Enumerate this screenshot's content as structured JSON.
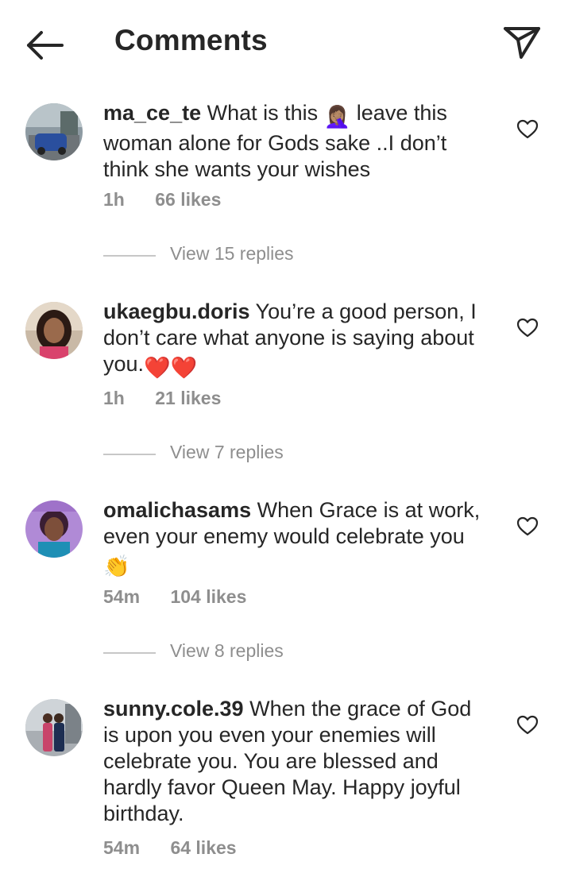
{
  "header": {
    "title": "Comments",
    "back_icon": "arrow-left-icon",
    "send_icon": "paper-plane-icon"
  },
  "colors": {
    "text": "#262626",
    "secondary": "#8e8e8e",
    "divider": "#c7c7c7",
    "heart_emoji": "#e0245e",
    "clap_emoji": "#f7c238"
  },
  "comments": [
    {
      "username": "ma_ce_te",
      "text_part1": " What is this ",
      "emoji": "🤦🏽‍♀️",
      "text_part2": " leave this woman alone for Gods sake ..I don’t think she wants your wishes",
      "time": "1h",
      "likes": "66 likes",
      "replies": "View 15 replies"
    },
    {
      "username": "ukaegbu.doris",
      "text_part1": " You’re a good person, I don’t care what anyone is saying about you.",
      "emoji": "❤️❤️",
      "time": "1h",
      "likes": "21 likes",
      "replies": "View 7 replies"
    },
    {
      "username": "omalichasams",
      "text_part1": " When Grace is at work, even your enemy would celebrate you ",
      "emoji": "👏",
      "time": "54m",
      "likes": "104 likes",
      "replies": "View 8 replies"
    },
    {
      "username": "sunny.cole.39",
      "text_part1": " When the grace of God is upon you even your enemies will celebrate you. You are blessed and hardly favor Queen May. Happy joyful birthday.",
      "time": "54m",
      "likes": "64 likes"
    }
  ]
}
